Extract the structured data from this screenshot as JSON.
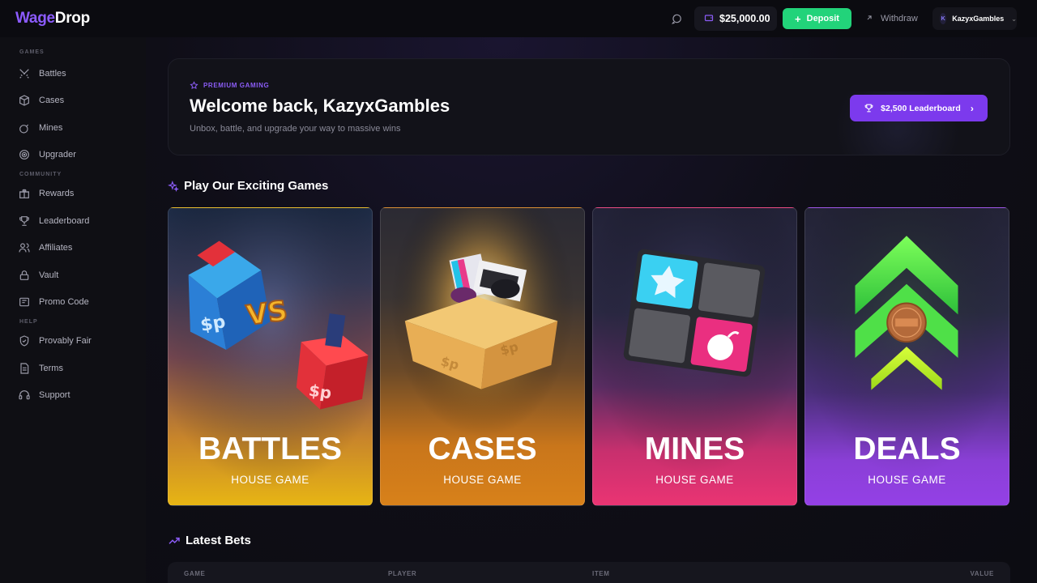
{
  "brand": {
    "part1": "Wage",
    "part2": "Drop"
  },
  "header": {
    "balance": "$25,000.00",
    "deposit_label": "Deposit",
    "withdraw_label": "Withdraw",
    "username": "KazyxGambles",
    "avatar_initial": "K"
  },
  "sidebar": {
    "sections": [
      {
        "title": "GAMES",
        "items": [
          {
            "label": "Battles",
            "icon": "swords-icon"
          },
          {
            "label": "Cases",
            "icon": "box-icon"
          },
          {
            "label": "Mines",
            "icon": "bomb-icon"
          },
          {
            "label": "Upgrader",
            "icon": "target-icon"
          }
        ]
      },
      {
        "title": "COMMUNITY",
        "items": [
          {
            "label": "Rewards",
            "icon": "gift-icon"
          },
          {
            "label": "Leaderboard",
            "icon": "trophy-icon"
          },
          {
            "label": "Affiliates",
            "icon": "users-icon"
          },
          {
            "label": "Vault",
            "icon": "lock-icon"
          },
          {
            "label": "Promo Code",
            "icon": "ticket-icon"
          }
        ]
      },
      {
        "title": "HELP",
        "items": [
          {
            "label": "Provably Fair",
            "icon": "shield-icon"
          },
          {
            "label": "Terms",
            "icon": "document-icon"
          },
          {
            "label": "Support",
            "icon": "headset-icon"
          }
        ]
      }
    ]
  },
  "welcome": {
    "tag": "PREMIUM GAMING",
    "title": "Welcome back, KazyxGambles",
    "subtitle": "Unbox, battle, and upgrade your way to massive wins",
    "leaderboard_button": "$2,500 Leaderboard"
  },
  "games_section": {
    "title": "Play Our Exciting Games",
    "cards": [
      {
        "title": "BATTLES",
        "subtitle": "HOUSE GAME"
      },
      {
        "title": "CASES",
        "subtitle": "HOUSE GAME"
      },
      {
        "title": "MINES",
        "subtitle": "HOUSE GAME"
      },
      {
        "title": "DEALS",
        "subtitle": "HOUSE GAME"
      }
    ]
  },
  "bets_section": {
    "title": "Latest Bets",
    "columns": [
      "GAME",
      "PLAYER",
      "ITEM",
      "VALUE"
    ]
  },
  "colors": {
    "accent": "#7c3aed",
    "deposit": "#22d37a",
    "battles": "#e7b514",
    "cases": "#d8811a",
    "mines": "#ea3473",
    "deals": "#9440e6"
  }
}
